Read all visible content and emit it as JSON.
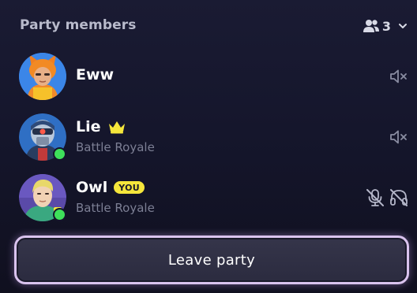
{
  "header": {
    "title": "Party members",
    "member_count": "3",
    "count_icon": "people-icon",
    "dropdown_icon": "chevron-down-icon"
  },
  "members": [
    {
      "name": "Eww",
      "mode": "",
      "online": false,
      "crown": false,
      "you": false,
      "icons": [
        "speaker-muted-icon"
      ]
    },
    {
      "name": "Lie",
      "mode": "Battle Royale",
      "online": true,
      "crown": true,
      "you": false,
      "icons": [
        "speaker-muted-icon"
      ]
    },
    {
      "name": "Owl",
      "mode": "Battle Royale",
      "online": true,
      "crown": false,
      "you": true,
      "you_label": "YOU",
      "icons": [
        "microphone-off-icon",
        "headphones-off-icon"
      ]
    }
  ],
  "leave_button": {
    "label": "Leave party"
  },
  "colors": {
    "background": "#15162c",
    "online": "#3ee05a",
    "crown": "#f5e63b",
    "you_badge": "#f5e63b",
    "button_border": "#d9c3ee"
  }
}
